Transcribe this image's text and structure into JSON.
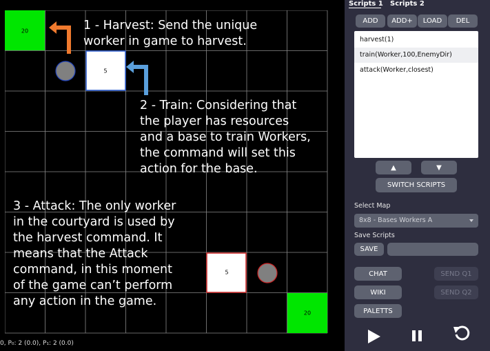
{
  "game": {
    "status_bar": "0, P₀: 2 (0.0), P₁: 2 (0.0)",
    "bases": [
      {
        "label": "20",
        "color": "#00e600"
      },
      {
        "label": "20",
        "color": "#00e600"
      }
    ],
    "barracks": [
      {
        "label": "5",
        "border": "#2255cc"
      },
      {
        "label": "5",
        "border": "#cc2222"
      }
    ],
    "annotations": {
      "harvest": "1 - Harvest: Send the unique\nworker in game to harvest.",
      "train": "2 - Train: Considering that\nthe player has resources\nand a base to train Workers,\nthe command will set this\naction for the base.",
      "attack": "3 - Attack: The only worker\nin the courtyard is used by\nthe harvest command. It\nmeans that the Attack\ncommand, in this moment\nof the game can’t perform\nany action in the game."
    },
    "arrow_colors": {
      "orange": "#f07a2e",
      "blue": "#5a9fdc"
    }
  },
  "panel": {
    "tabs": [
      "Scripts 1",
      "Scripts 2"
    ],
    "buttons": {
      "add": "ADD",
      "add_plus": "ADD+",
      "load": "LOAD",
      "del": "DEL"
    },
    "scripts": [
      "harvest(1)",
      "train(Worker,100,EnemyDir)",
      "attack(Worker,closest)"
    ],
    "up": "▲",
    "down": "▼",
    "switch_scripts": "SWITCH SCRIPTS",
    "select_map_label": "Select Map",
    "map_value": "8x8 - Bases Workers A",
    "save_scripts_label": "Save Scripts",
    "save": "SAVE",
    "chat": "CHAT",
    "wiki": "WIKI",
    "palettes": "PALETTS",
    "send_q1": "SEND Q1",
    "send_q2": "SEND Q2",
    "icons": [
      "play-icon",
      "pause-icon",
      "restart-icon"
    ]
  }
}
